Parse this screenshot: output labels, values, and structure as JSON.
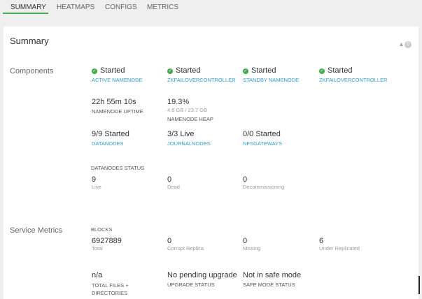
{
  "tabs": [
    {
      "label": "SUMMARY",
      "active": true
    },
    {
      "label": "HEATMAPS"
    },
    {
      "label": "CONFIGS"
    },
    {
      "label": "METRICS"
    }
  ],
  "summary": {
    "title": "Summary",
    "alerts_count": "0",
    "icon": "bell-icon"
  },
  "components": {
    "label": "Components",
    "masters": [
      {
        "status": "Started",
        "name": "ACTIVE NAMENODE"
      },
      {
        "status": "Started",
        "name": "ZKFAILOVERCONTROLLER"
      },
      {
        "status": "Started",
        "name": "STANDBY NAMENODE"
      },
      {
        "status": "Started",
        "name": "ZKFAILOVERCONTROLLER"
      }
    ],
    "uptime": {
      "value": "22h 55m 10s",
      "label": "NAMENODE UPTIME"
    },
    "heap": {
      "value": "19.3%",
      "detail": "4.6 GB / 23.7 GB",
      "label": "NAMENODE HEAP"
    },
    "slaves": [
      {
        "value": "9/9 Started",
        "name": "DATANODES"
      },
      {
        "value": "3/3 Live",
        "name": "JOURNALNODES"
      },
      {
        "value": "0/0 Started",
        "name": "NFSGATEWAYS"
      }
    ],
    "datanodes_status": {
      "label": "DATANODES STATUS",
      "items": [
        {
          "value": "9",
          "label": "Live"
        },
        {
          "value": "0",
          "label": "Dead"
        },
        {
          "value": "0",
          "label": "Decommissioning"
        }
      ]
    }
  },
  "service_metrics": {
    "label": "Service Metrics",
    "blocks": {
      "label": "BLOCKS",
      "items": [
        {
          "value": "6927889",
          "label": "Total"
        },
        {
          "value": "0",
          "label": "Corrupt Replica"
        },
        {
          "value": "0",
          "label": "Missing"
        },
        {
          "value": "6",
          "label": "Under Replicated"
        }
      ]
    },
    "others": [
      {
        "value": "n/a",
        "label": "TOTAL FILES + DIRECTORIES"
      },
      {
        "value": "No pending upgrade",
        "label": "UPGRADE STATUS"
      },
      {
        "value": "Not in safe mode",
        "label": "SAFE MODE STATUS"
      }
    ]
  },
  "colors": {
    "accent": "#3fae49",
    "link": "#2a9fd6"
  }
}
